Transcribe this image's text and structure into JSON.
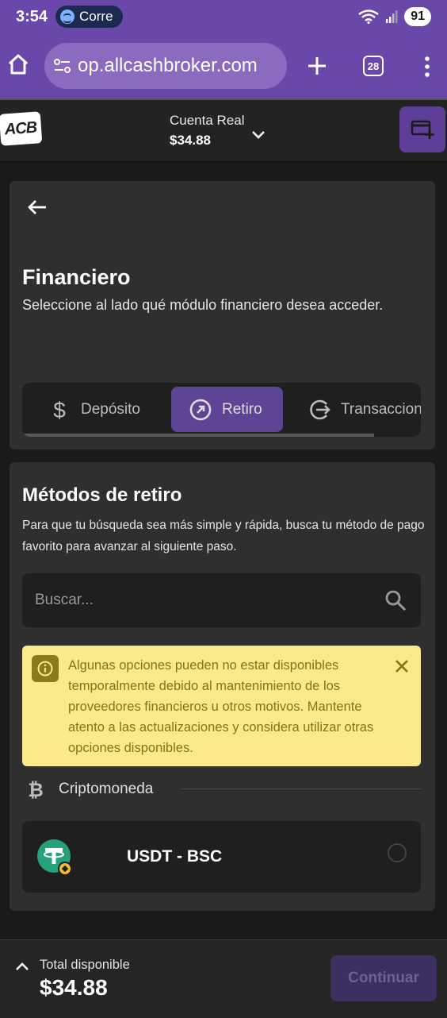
{
  "status_bar": {
    "time": "3:54",
    "media_label": "Corre",
    "battery": "91"
  },
  "browser": {
    "url": "op.allcashbroker.com",
    "tab_count": "28"
  },
  "header": {
    "logo_text": "ACB",
    "account_label": "Cuenta Real",
    "account_balance": "$34.88"
  },
  "financiero": {
    "title": "Financiero",
    "description": "Seleccione al lado qué módulo financiero desea acceder.",
    "tabs": [
      {
        "label": "Depósito",
        "icon": "dollar-icon",
        "active": false
      },
      {
        "label": "Retiro",
        "icon": "arrow-up-right-circle-icon",
        "active": true
      },
      {
        "label": "Transacciones",
        "icon": "history-icon",
        "active": false
      }
    ]
  },
  "metodos": {
    "title": "Métodos de retiro",
    "description": "Para que tu búsqueda sea más simple y rápida, busca tu método de pago favorito para avanzar al siguiente paso.",
    "search_placeholder": "Buscar...",
    "alert_text": "Algunas opciones pueden no estar disponibles temporalmente debido al mantenimiento de los proveedores financieros u otros motivos. Mantente atento a las actualizaciones y considera utilizar otras opciones disponibles.",
    "category": "Criptomoneda",
    "items": [
      {
        "label": "USDT - BSC",
        "icon": "tether-icon",
        "selected": false
      }
    ]
  },
  "footer": {
    "total_label": "Total disponible",
    "total_amount": "$34.88",
    "continue_label": "Continuar"
  },
  "colors": {
    "brand_purple": "#6a48a9",
    "active_tab": "#5e4494",
    "alert_bg": "#fbe98c",
    "alert_text": "#857511"
  }
}
